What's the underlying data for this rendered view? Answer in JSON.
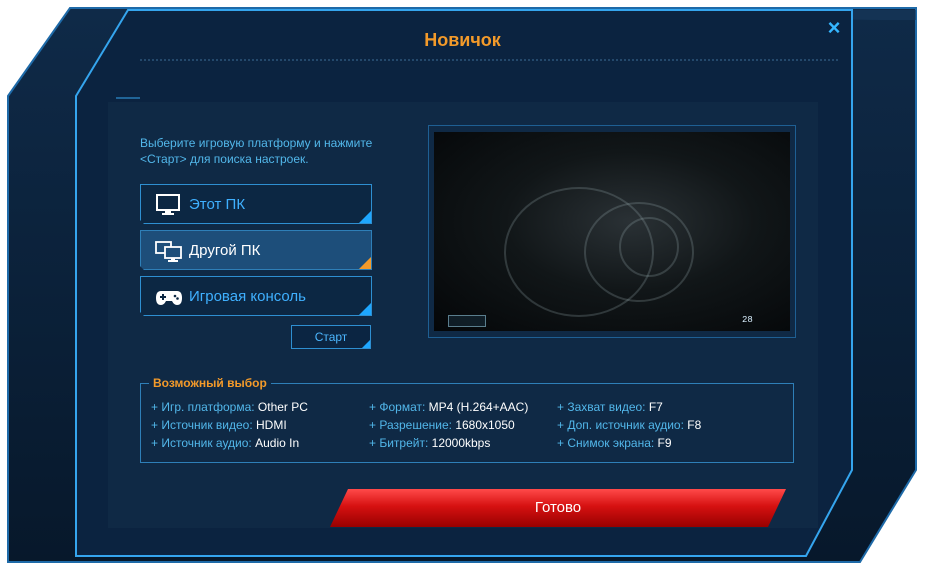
{
  "window": {
    "title": "Новичок",
    "close_label": "×"
  },
  "instructions": "Выберите игровую платформу и нажмите <Старт> для поиска настроек.",
  "platforms": [
    {
      "label": "Этот ПК",
      "icon": "monitor-icon",
      "active": false
    },
    {
      "label": "Другой ПК",
      "icon": "dual-monitor-icon",
      "active": true
    },
    {
      "label": "Игровая консоль",
      "icon": "gamepad-icon",
      "active": false
    }
  ],
  "start_label": "Старт",
  "preview": {
    "hud_right": "28"
  },
  "options": {
    "title": "Возможный выбор",
    "col1": [
      {
        "key": "+ Игр. платформа: ",
        "value": "Other PC"
      },
      {
        "key": "+ Источник видео: ",
        "value": "HDMI"
      },
      {
        "key": "+ Источник аудио: ",
        "value": "Audio In"
      }
    ],
    "col2": [
      {
        "key": "+ Формат: ",
        "value": "MP4 (H.264+AAC)"
      },
      {
        "key": "+ Разрешение: ",
        "value": "1680x1050"
      },
      {
        "key": "+ Битрейт: ",
        "value": "12000kbps"
      }
    ],
    "col3": [
      {
        "key": "+ Захват видео: ",
        "value": "F7"
      },
      {
        "key": "+ Доп. источник аудио: ",
        "value": "F8"
      },
      {
        "key": "+ Снимок экрана: ",
        "value": "F9"
      }
    ]
  },
  "done_label": "Готово",
  "colors": {
    "accent_orange": "#f39a2a",
    "accent_blue": "#1ea7ff",
    "panel_bg": "#0f2945",
    "done_red": "#d61111"
  }
}
